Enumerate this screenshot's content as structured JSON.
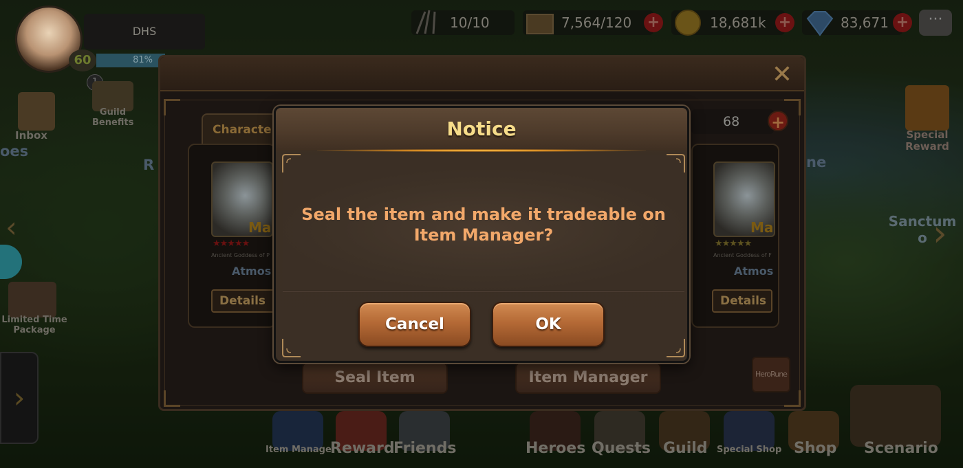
{
  "player": {
    "name": "DHS",
    "level": "60",
    "exp": "81%",
    "guild_badge": "1"
  },
  "resources": [
    {
      "name": "stamina",
      "icon": "arrows-icon",
      "value": "10/10"
    },
    {
      "name": "tokens",
      "icon": "ticket-icon",
      "value": "7,564/120"
    },
    {
      "name": "gold",
      "icon": "gold-coin-icon",
      "value": "18,681k"
    },
    {
      "name": "gems",
      "icon": "diamond-icon",
      "value": "83,671"
    }
  ],
  "side_left": {
    "inbox": "Inbox",
    "guild_benefits": "Guild Benefits",
    "heroes_partial": "oes",
    "r_partial": "R",
    "limited_time": "Limited Time Package"
  },
  "side_right": {
    "special_reward": "Special Reward",
    "sanctum_partial": "Sanctum o",
    "ne_partial": "ne"
  },
  "bottom_nav": {
    "item_manager": "Item Manager",
    "reward": "Reward",
    "friends": "Friends",
    "heroes": "Heroes",
    "quests": "Quests",
    "guild": "Guild",
    "special_shop": "Special Shop",
    "shop": "Shop",
    "scenario": "Scenario"
  },
  "panel": {
    "close": "✕",
    "tab": "Character",
    "count": "68",
    "left_card": {
      "tag": "Ma",
      "subtitle": "Ancient Goddess of P",
      "name": "Atmos",
      "details": "Details",
      "stars": "★★★★★"
    },
    "right_card": {
      "tag": "Ma",
      "subtitle": "Ancient Goddess of F",
      "name": "Atmos",
      "details": "Details",
      "stars": "★★★★★"
    },
    "seal_button": "Seal Item",
    "manager_button": "Item Manager",
    "herorune_button": "HeroRune"
  },
  "dialog": {
    "title": "Notice",
    "message_line1": "Seal the item and make it tradeable on",
    "message_line2": "Item Manager?",
    "cancel": "Cancel",
    "ok": "OK"
  },
  "colors": {
    "title": "#f6dc8a",
    "message": "#f2a86a",
    "button": "#b56a36"
  }
}
